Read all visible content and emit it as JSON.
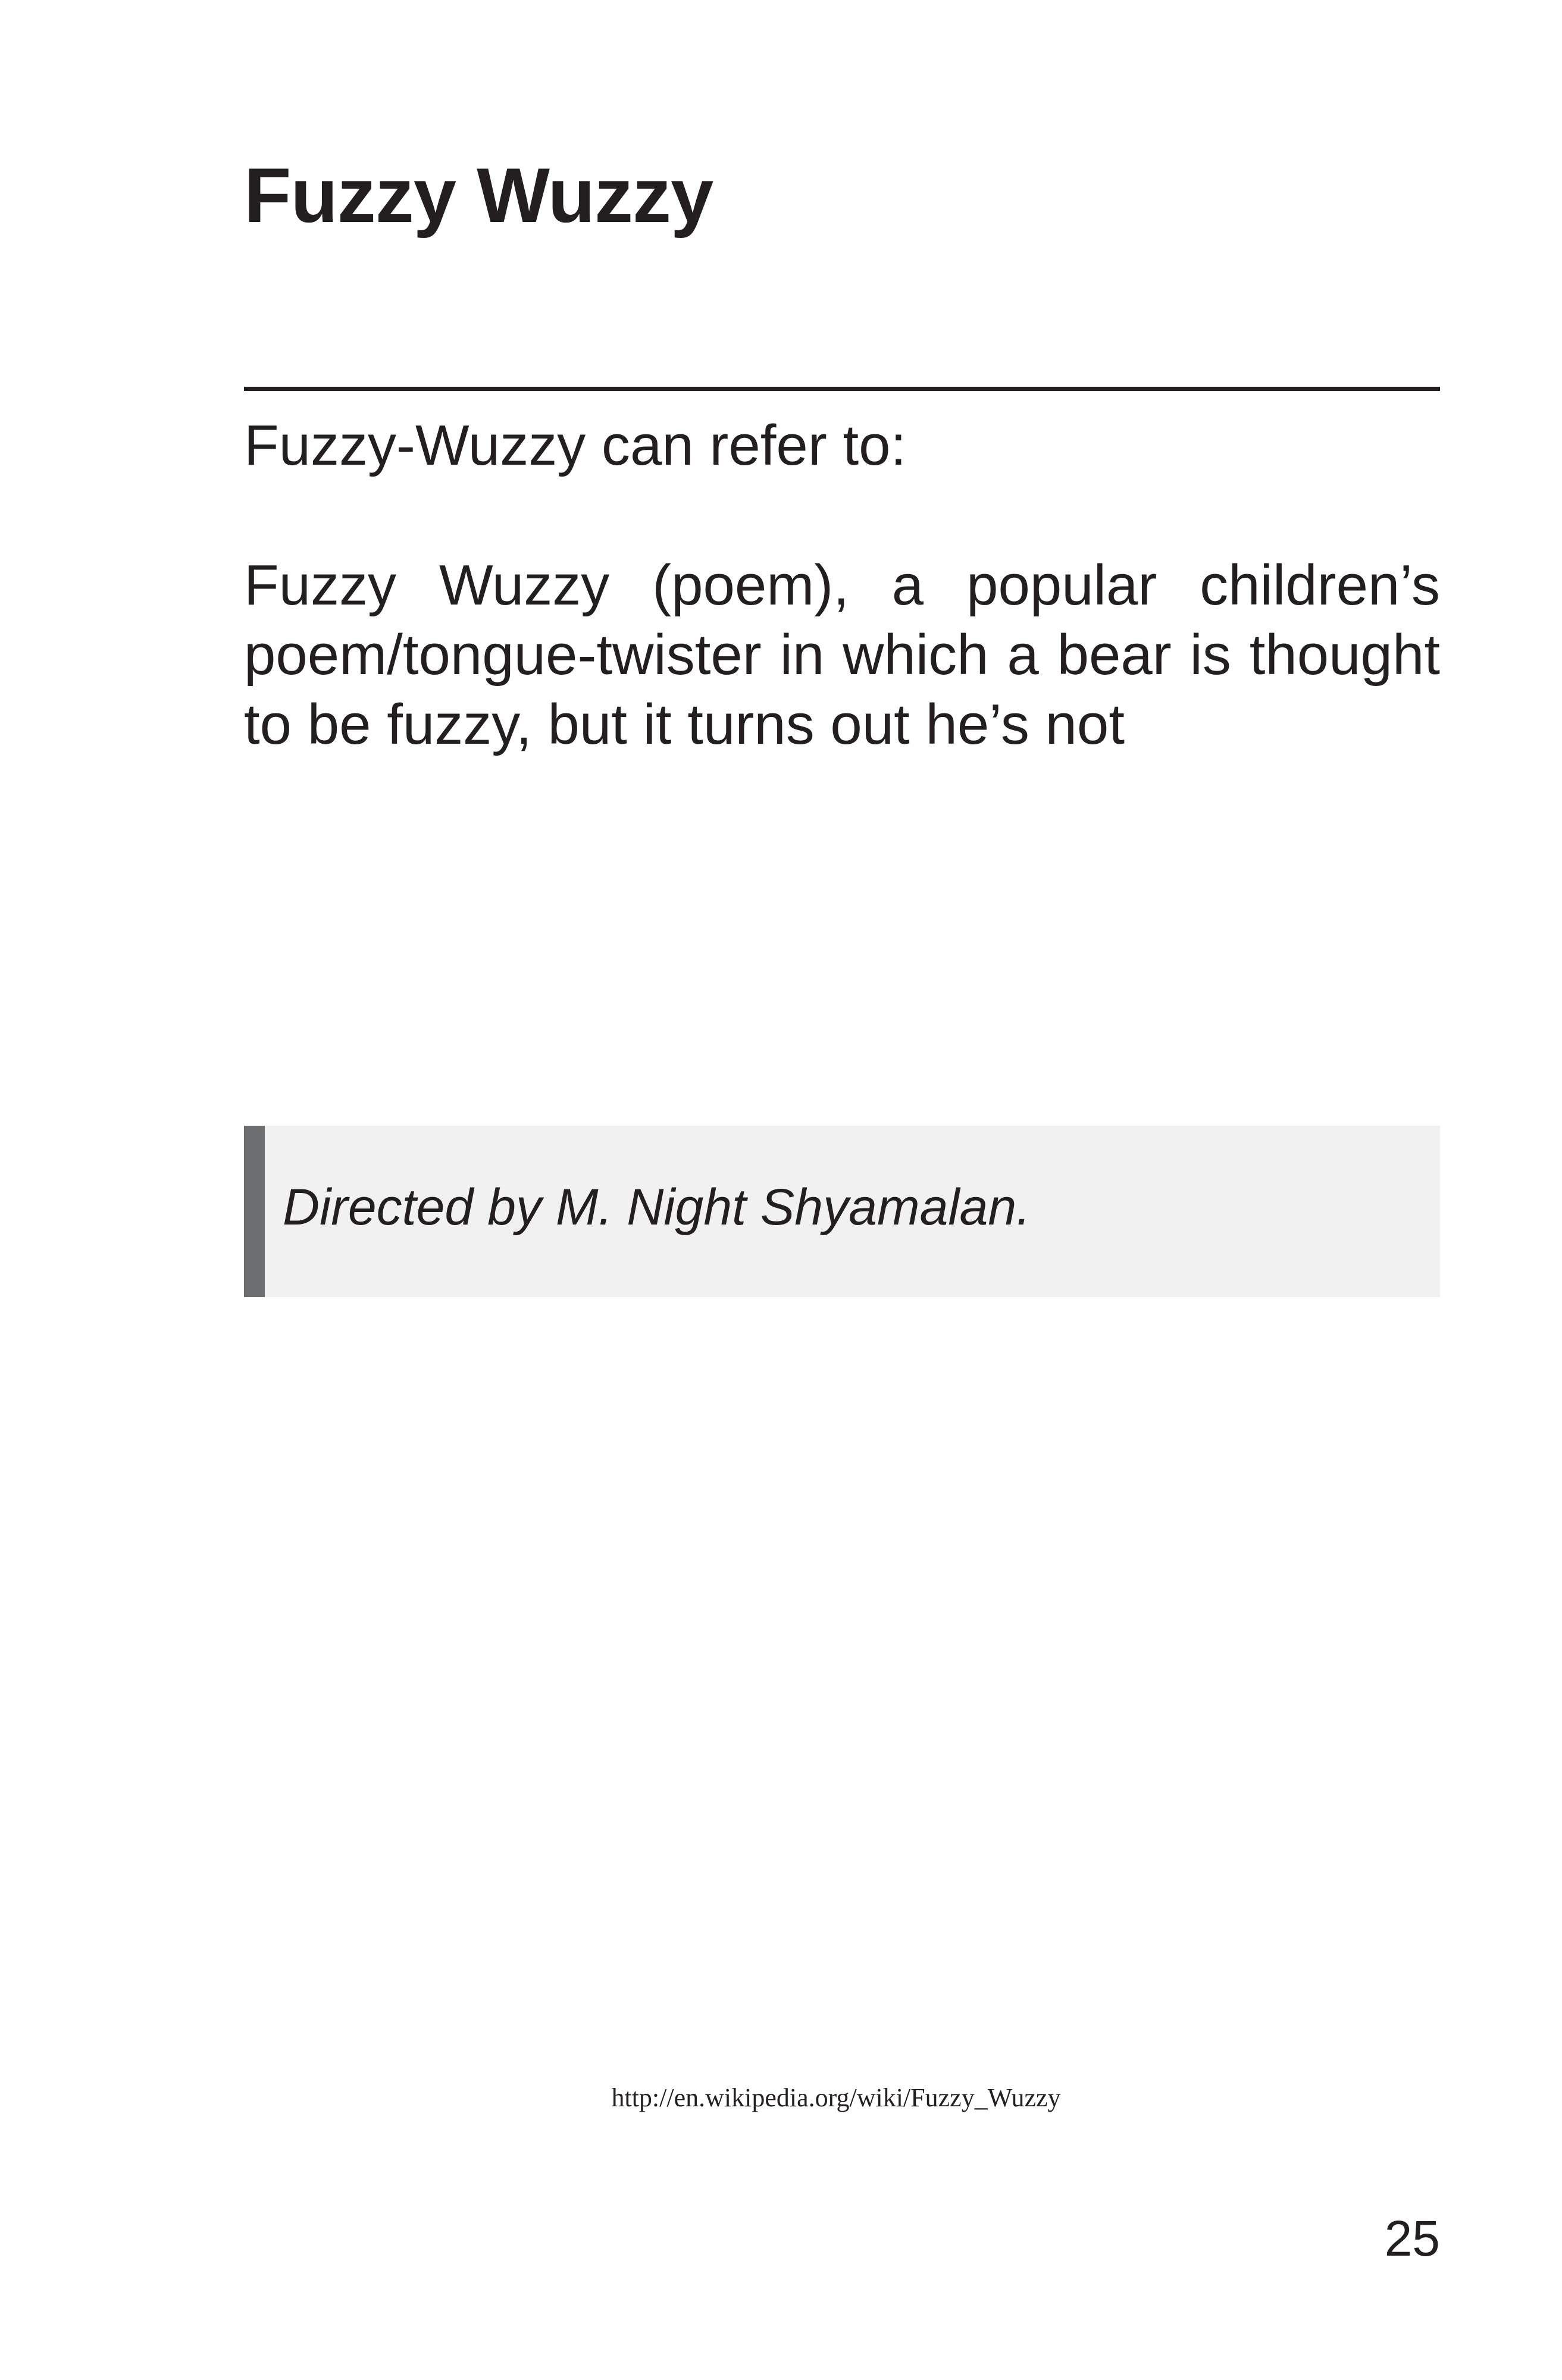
{
  "page": {
    "title": "Fuzzy Wuzzy",
    "intro": "Fuzzy-Wuzzy can refer to:",
    "entries": [
      {
        "text": "Fuzzy Wuzzy (poem), a popular children’s poem/tongue-twister in which a bear is thought to be fuzzy, but it turns out he’s not"
      }
    ],
    "quote": "Directed by M. Night Shyamalan.",
    "source_url": "http://en.wikipedia.org/wiki/Fuzzy_Wuzzy",
    "page_number": "25"
  }
}
